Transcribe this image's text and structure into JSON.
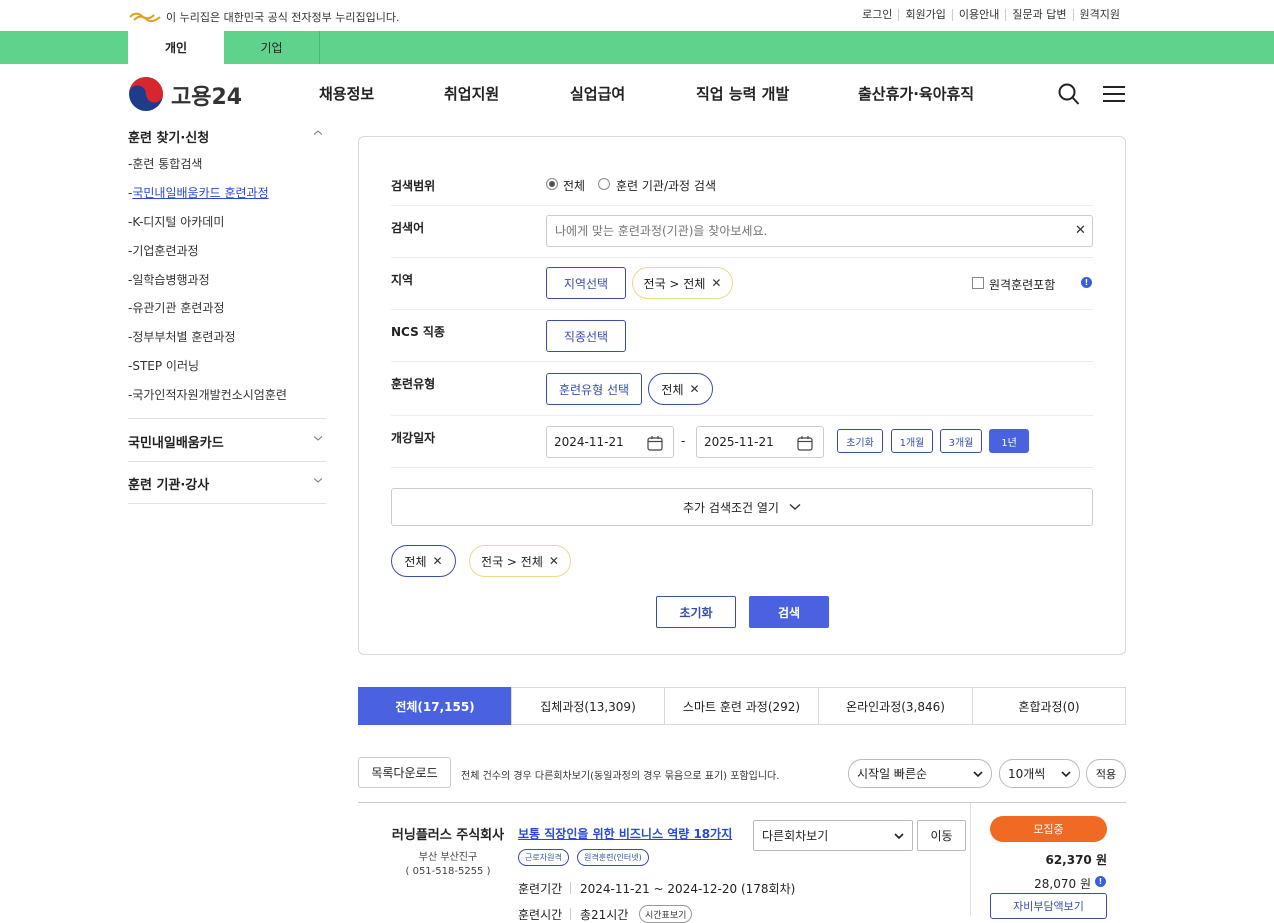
{
  "gov_bar": {
    "notice": "이 누리집은 대한민국 공식 전자정부 누리집입니다.",
    "links": [
      "로그인",
      "회원가입",
      "이용안내",
      "질문과 답변",
      "원격지원"
    ]
  },
  "site_tabs": [
    "개인",
    "기업"
  ],
  "header": {
    "logo_text": "고용24",
    "nav": [
      "채용정보",
      "취업지원",
      "실업급여",
      "직업 능력 개발",
      "출산휴가·육아휴직"
    ]
  },
  "sidebar": {
    "section1": "훈련 찾기·신청",
    "items": [
      "훈련 통합검색",
      "국민내일배움카드 훈련과정",
      "K-디지털 아카데미",
      "기업훈련과정",
      "일학습병행과정",
      "유관기관 훈련과정",
      "정부부처별 훈련과정",
      "STEP 이러닝",
      "국가인적자원개발컨소시엄훈련"
    ],
    "section2": "국민내일배움카드",
    "section3": "훈련 기관·강사"
  },
  "search": {
    "scope_label": "검색범위",
    "scope_all": "전체",
    "scope_org": "훈련 기관/과정 검색",
    "keyword_label": "검색어",
    "keyword_placeholder": "나에게 맞는 훈련과정(기관)을 찾아보세요.",
    "region_label": "지역",
    "region_btn": "지역선택",
    "region_chip": "전국 > 전체",
    "remote_label": "원격훈련포함",
    "ncs_label": "NCS 직종",
    "ncs_btn": "직종선택",
    "type_label": "훈련유형",
    "type_btn": "훈련유형 선택",
    "type_chip": "전체",
    "date_label": "개강일자",
    "date_from": "2024-11-21",
    "date_to": "2025-11-21",
    "date_dash": "-",
    "periods": [
      "초기화",
      "1개월",
      "3개월",
      "1년"
    ],
    "more": "추가 검색조건 열기",
    "selected_chips": [
      "전체",
      "전국 > 전체"
    ],
    "reset": "초기화",
    "submit": "검색"
  },
  "result_tabs": [
    "전체(17,155)",
    "집체과정(13,309)",
    "스마트 훈련 과정(292)",
    "온라인과정(3,846)",
    "혼합과정(0)"
  ],
  "list_toolbar": {
    "download": "목록다운로드",
    "note": "전체 건수의 경우 다른회차보기(동일과정의 경우 묶음으로 표기) 포함입니다.",
    "sort": "시작일 빠른순",
    "per_page": "10개씩",
    "apply": "적용"
  },
  "result": {
    "org": "러닝플러스 주식회사",
    "region": "부산 부산진구",
    "phone": "( 051-518-5255 )",
    "title": "보통 직장인을 위한 비즈니스 역량 18가지",
    "tags": [
      "근로자원격",
      "원격훈련(인터넷)"
    ],
    "other_sel": "다른회차보기",
    "move": "이동",
    "period_k": "훈련기간",
    "period_v": "2024-11-21 ~ 2024-12-20 (178회차)",
    "time_k": "훈련시간",
    "time_v": "총21시간",
    "timetable": "시간표보기",
    "status": "모집중",
    "price": "62,370 원",
    "self_price": "28,070 원",
    "self_btn": "자비부담액보기"
  },
  "colors": {
    "green_bar": "#5fd28c",
    "primary": "#4a61e0",
    "orange": "#f06a24"
  }
}
